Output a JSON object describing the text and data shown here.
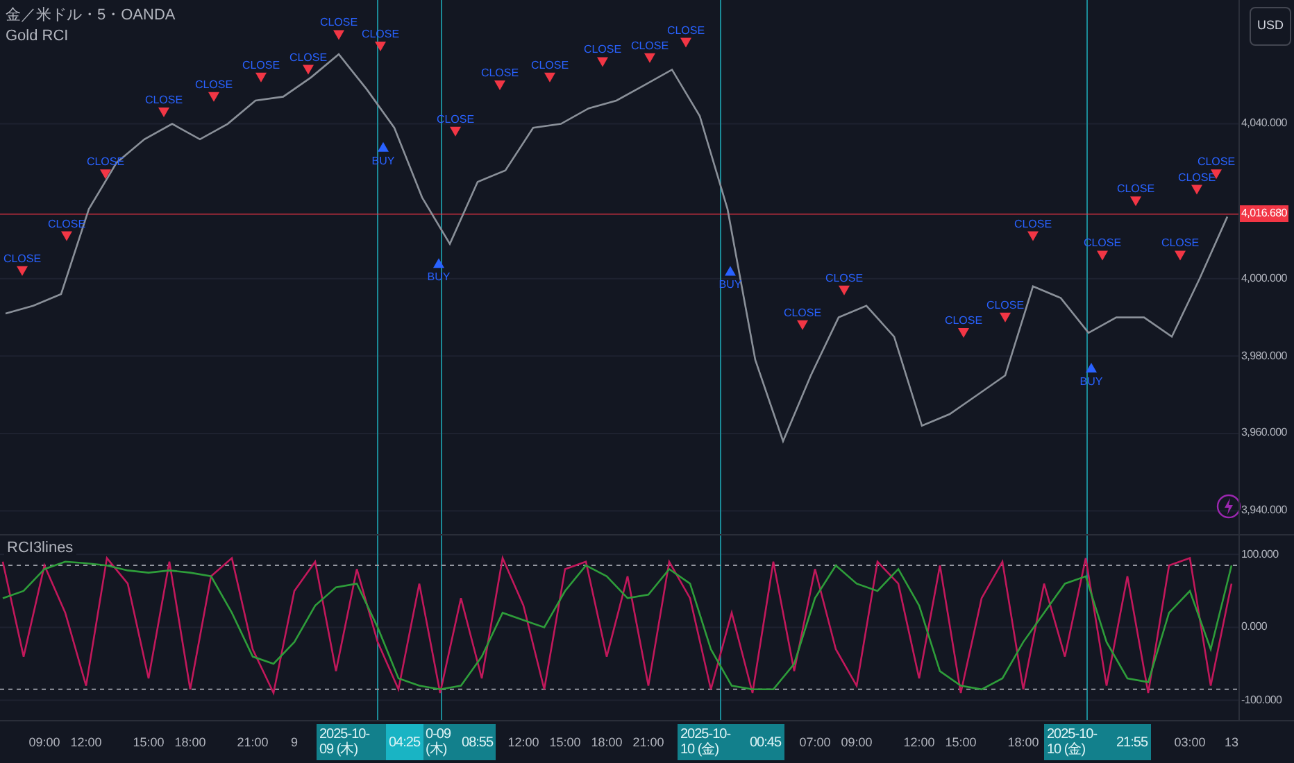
{
  "header": {
    "symbol": "金／米ドル・5・OANDA",
    "indicator": "Gold RCI"
  },
  "currency_button": "USD",
  "price_chart": {
    "chart_data": {
      "type": "line",
      "ylim": [
        3934,
        4072
      ],
      "grid": true,
      "series": [
        {
          "color": "#8a9099",
          "values": [
            3991,
            3993,
            3996,
            4018,
            4030,
            4036,
            4040,
            4036,
            4040,
            4046,
            4047,
            4052,
            4058,
            4049,
            4039,
            4021,
            4009,
            4025,
            4028,
            4039,
            4040,
            4044,
            4046,
            4050,
            4054,
            4042,
            4018,
            3979,
            3958,
            3975,
            3990,
            3993,
            3985,
            3962,
            3965,
            3970,
            3975,
            3998,
            3995,
            3986,
            3990,
            3990,
            3985,
            4000,
            4016
          ]
        }
      ],
      "yticks": [
        {
          "value": 4040,
          "label": "4,040.000"
        },
        {
          "value": 4000,
          "label": "4,000.000"
        },
        {
          "value": 3980,
          "label": "3,980.000"
        },
        {
          "value": 3960,
          "label": "3,960.000"
        },
        {
          "value": 3940,
          "label": "3,940.000"
        }
      ],
      "ref_lines": [
        {
          "axis": "y",
          "value": 4016.68,
          "label": "4,016.680",
          "color": "#f23645"
        }
      ]
    },
    "signals": [
      {
        "kind": "close",
        "label": "CLOSE"
      },
      {
        "kind": "close",
        "label": "CLOSE"
      },
      {
        "kind": "close",
        "label": "CLOSE"
      },
      {
        "kind": "close",
        "label": "CLOSE"
      },
      {
        "kind": "close",
        "label": "CLOSE"
      },
      {
        "kind": "close",
        "label": "CLOSE"
      },
      {
        "kind": "close",
        "label": "CLOSE"
      },
      {
        "kind": "close",
        "label": "CLOSE"
      },
      {
        "kind": "close",
        "label": "CLOSE"
      },
      {
        "kind": "buy",
        "label": "BUY"
      },
      {
        "kind": "buy",
        "label": "BUY"
      },
      {
        "kind": "close",
        "label": "CLOSE"
      },
      {
        "kind": "close",
        "label": "CLOSE"
      },
      {
        "kind": "close",
        "label": "CLOSE"
      },
      {
        "kind": "close",
        "label": "CLOSE"
      },
      {
        "kind": "close",
        "label": "CLOSE"
      },
      {
        "kind": "close",
        "label": "CLOSE"
      },
      {
        "kind": "buy",
        "label": "BUY"
      },
      {
        "kind": "close",
        "label": "CLOSE"
      },
      {
        "kind": "close",
        "label": "CLOSE"
      },
      {
        "kind": "close",
        "label": "CLOSE"
      },
      {
        "kind": "close",
        "label": "CLOSE"
      },
      {
        "kind": "close",
        "label": "CLOSE"
      },
      {
        "kind": "buy",
        "label": "BUY"
      },
      {
        "kind": "close",
        "label": "CLOSE"
      },
      {
        "kind": "close",
        "label": "CLOSE"
      },
      {
        "kind": "close",
        "label": "CLOSE"
      },
      {
        "kind": "close",
        "label": "CLOSE"
      },
      {
        "kind": "close",
        "label": "CLOSE"
      }
    ]
  },
  "rci_panel": {
    "title": "RCI3lines",
    "chart_data": {
      "type": "line",
      "ylim": [
        -127,
        126
      ],
      "grid": true,
      "categories": [
        null,
        null,
        "09:00",
        null,
        "12:00",
        null,
        null,
        "15:00",
        null,
        "18:00",
        null,
        null,
        "21:00",
        null,
        "9",
        null,
        null,
        null,
        null,
        null,
        null,
        null,
        null,
        null,
        null,
        "12:00",
        null,
        "15:00",
        null,
        "18:00",
        null,
        "21:00",
        null,
        null,
        null,
        null,
        null,
        null,
        null,
        "07:00",
        null,
        "09:00",
        null,
        null,
        "12:00",
        null,
        "15:00",
        null,
        null,
        "18:00",
        null,
        null,
        null,
        null,
        null,
        null,
        null,
        "03:00",
        null,
        "13"
      ],
      "series": [
        {
          "color": "#c2185b",
          "values": [
            90,
            -40,
            85,
            20,
            -80,
            95,
            60,
            -70,
            90,
            -85,
            70,
            95,
            -30,
            -90,
            50,
            90,
            -60,
            80,
            -20,
            -85,
            60,
            -90,
            40,
            -70,
            95,
            30,
            -85,
            80,
            90,
            -40,
            70,
            -80,
            90,
            40,
            -85,
            20,
            -90,
            90,
            -60,
            80,
            -30,
            -80,
            90,
            60,
            -70,
            85,
            -90,
            40,
            90,
            -85,
            60,
            -40,
            95,
            -80,
            70,
            -90,
            85,
            95,
            -80,
            60
          ]
        },
        {
          "color": "#2e9d3a",
          "values": [
            40,
            50,
            80,
            90,
            88,
            85,
            78,
            75,
            78,
            75,
            70,
            20,
            -40,
            -50,
            -20,
            30,
            55,
            60,
            0,
            -70,
            -80,
            -85,
            -80,
            -40,
            20,
            10,
            0,
            50,
            85,
            70,
            40,
            45,
            80,
            60,
            -30,
            -80,
            -85,
            -85,
            -50,
            40,
            85,
            60,
            50,
            80,
            30,
            -60,
            -80,
            -85,
            -70,
            -20,
            20,
            60,
            70,
            -20,
            -70,
            -75,
            20,
            50,
            -30,
            85
          ]
        }
      ],
      "yticks": [
        {
          "value": 100,
          "label": "100.000"
        },
        {
          "value": 0,
          "label": "0.000"
        },
        {
          "value": -100,
          "label": "-100.000"
        }
      ],
      "ref_lines": [
        {
          "axis": "y",
          "value": 85
        },
        {
          "axis": "y",
          "value": -85
        }
      ]
    }
  },
  "crosshair_labels": [
    {
      "parts": [
        {
          "text": "2025-10-09 (木)",
          "selected": false
        },
        {
          "text": "04:25",
          "selected": true
        },
        {
          "text": "0-09 (木)",
          "selected": false
        },
        {
          "text": "08:55",
          "selected": false
        }
      ]
    },
    {
      "parts": [
        {
          "text": "2025-10-10 (金)",
          "selected": false
        },
        {
          "text": "00:45",
          "selected": false
        }
      ]
    },
    {
      "parts": [
        {
          "text": "2025-10-10 (金)",
          "selected": false
        },
        {
          "text": "21:55",
          "selected": false
        }
      ]
    }
  ]
}
